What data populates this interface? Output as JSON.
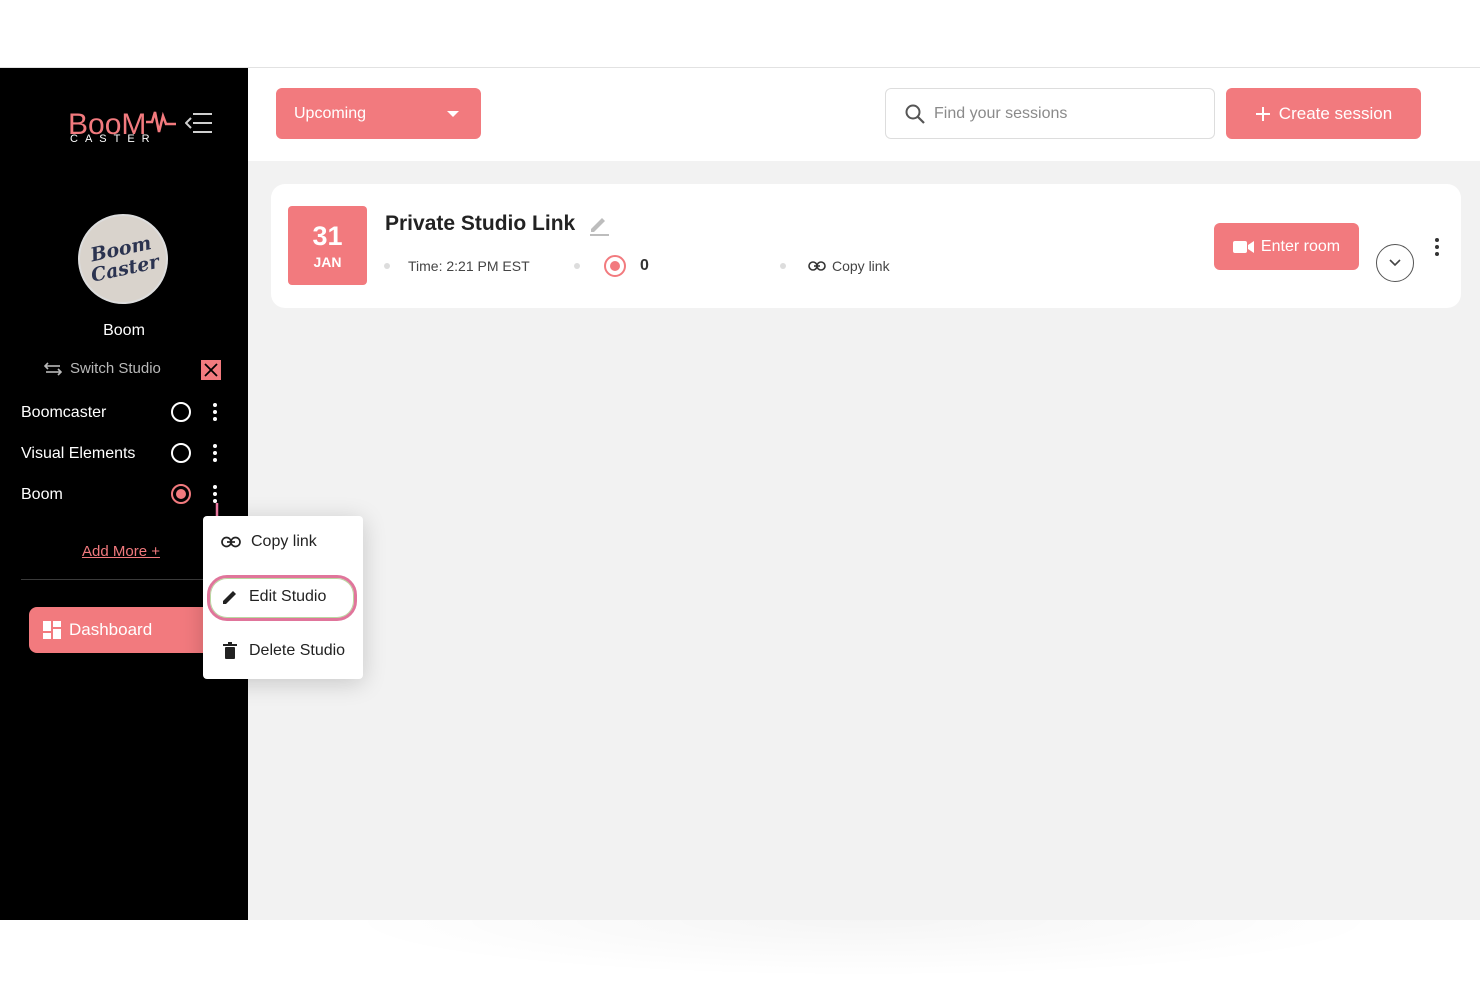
{
  "brand": {
    "logo_word": "BooM",
    "logo_sub": "CASTER",
    "accent": "#f27a7e"
  },
  "sidebar": {
    "avatar_text": "Boom Caster",
    "studio_name": "Boom",
    "switch_label": "Switch Studio",
    "studios": [
      {
        "label": "Boomcaster",
        "selected": false
      },
      {
        "label": "Visual Elements",
        "selected": false
      },
      {
        "label": "Boom",
        "selected": true
      }
    ],
    "add_more": "Add More +",
    "dashboard": "Dashboard"
  },
  "dropdown": {
    "items": [
      {
        "label": "Copy link",
        "icon": "link-icon"
      },
      {
        "label": "Edit Studio",
        "icon": "pencil-icon"
      },
      {
        "label": "Delete Studio",
        "icon": "trash-icon"
      }
    ]
  },
  "topbar": {
    "filter_label": "Upcoming",
    "search_placeholder": "Find your sessions",
    "create_label": "Create session"
  },
  "session": {
    "day": "31",
    "month": "JAN",
    "title": "Private Studio Link",
    "time": "Time: 2:21 PM EST",
    "recordings": "0",
    "copy_link": "Copy link",
    "enter_room": "Enter room"
  }
}
